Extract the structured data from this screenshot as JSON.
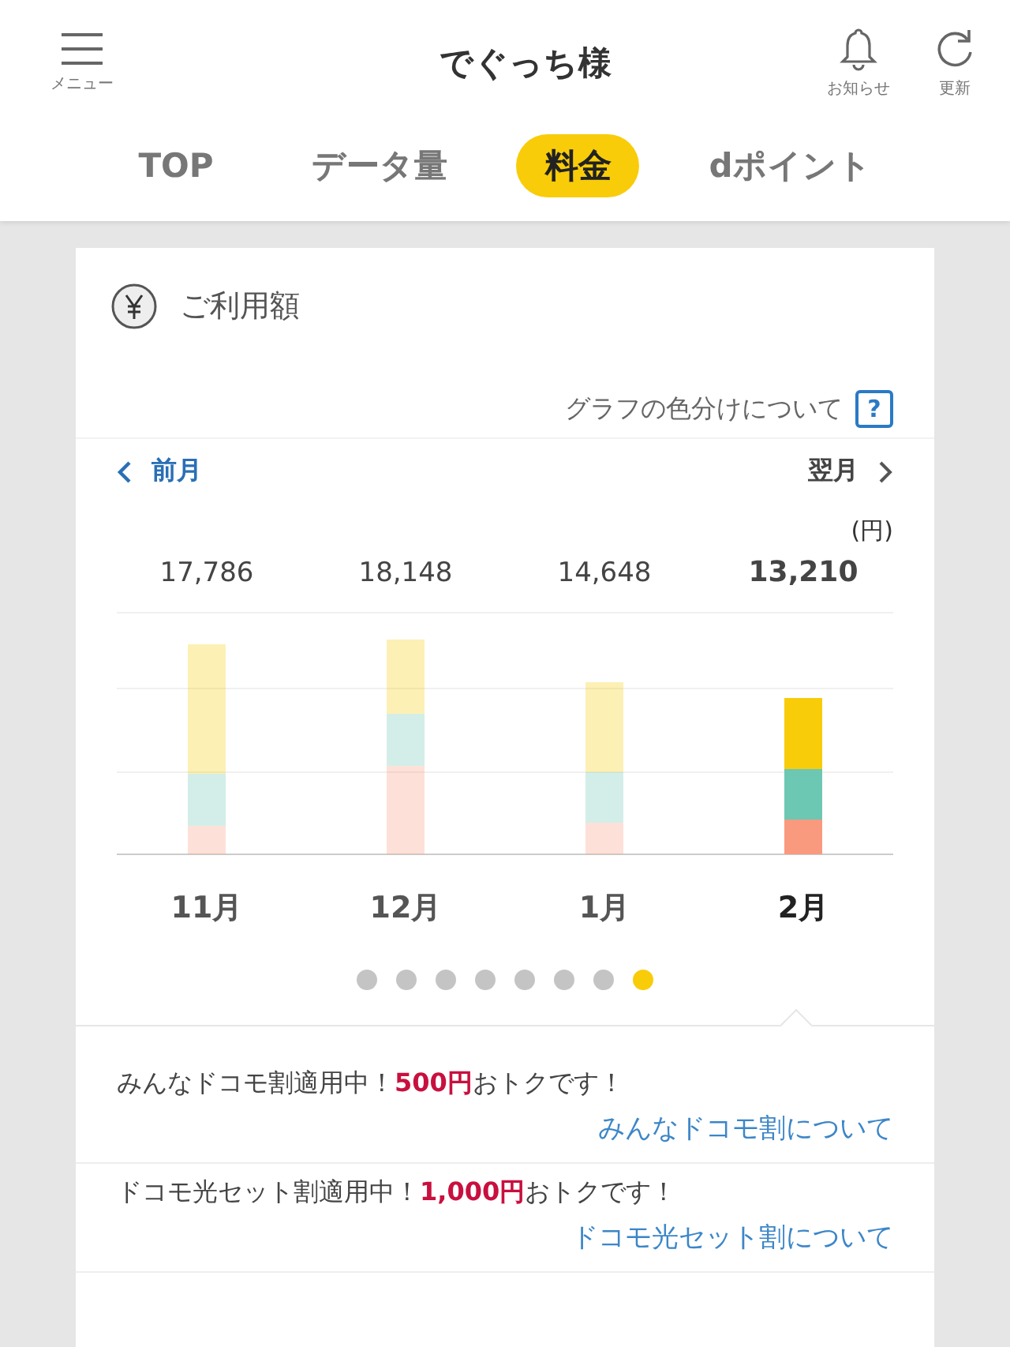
{
  "header": {
    "menu_label": "メニュー",
    "title": "でぐっち様",
    "notice_label": "お知らせ",
    "refresh_label": "更新"
  },
  "tabs": [
    {
      "label": "TOP",
      "selected": false
    },
    {
      "label": "データ量",
      "selected": false
    },
    {
      "label": "料金",
      "selected": true
    },
    {
      "label": "dポイント",
      "selected": false
    }
  ],
  "card": {
    "title": "ご利用額",
    "help_text": "グラフの色分けについて",
    "help_button": "?",
    "prev_label": "前月",
    "next_label": "翌月",
    "unit": "(円)",
    "months": [
      {
        "label": "11月",
        "total": "17,786",
        "selected": false
      },
      {
        "label": "12月",
        "total": "18,148",
        "selected": false
      },
      {
        "label": "1月",
        "total": "14,648",
        "selected": false
      },
      {
        "label": "2月",
        "total": "13,210",
        "selected": true
      }
    ],
    "pager": [
      {
        "selected": false
      },
      {
        "selected": false
      },
      {
        "selected": false
      },
      {
        "selected": false
      },
      {
        "selected": false
      },
      {
        "selected": false
      },
      {
        "selected": false
      },
      {
        "selected": true
      }
    ]
  },
  "promos": [
    {
      "text": "みんなドコモ割適用中！**500円**おトクです！",
      "link": "みんなドコモ割について"
    },
    {
      "text": "ドコモ光セット割適用中！**1,000円**おトクです！",
      "link": "ドコモ光セット割について"
    }
  ]
}
